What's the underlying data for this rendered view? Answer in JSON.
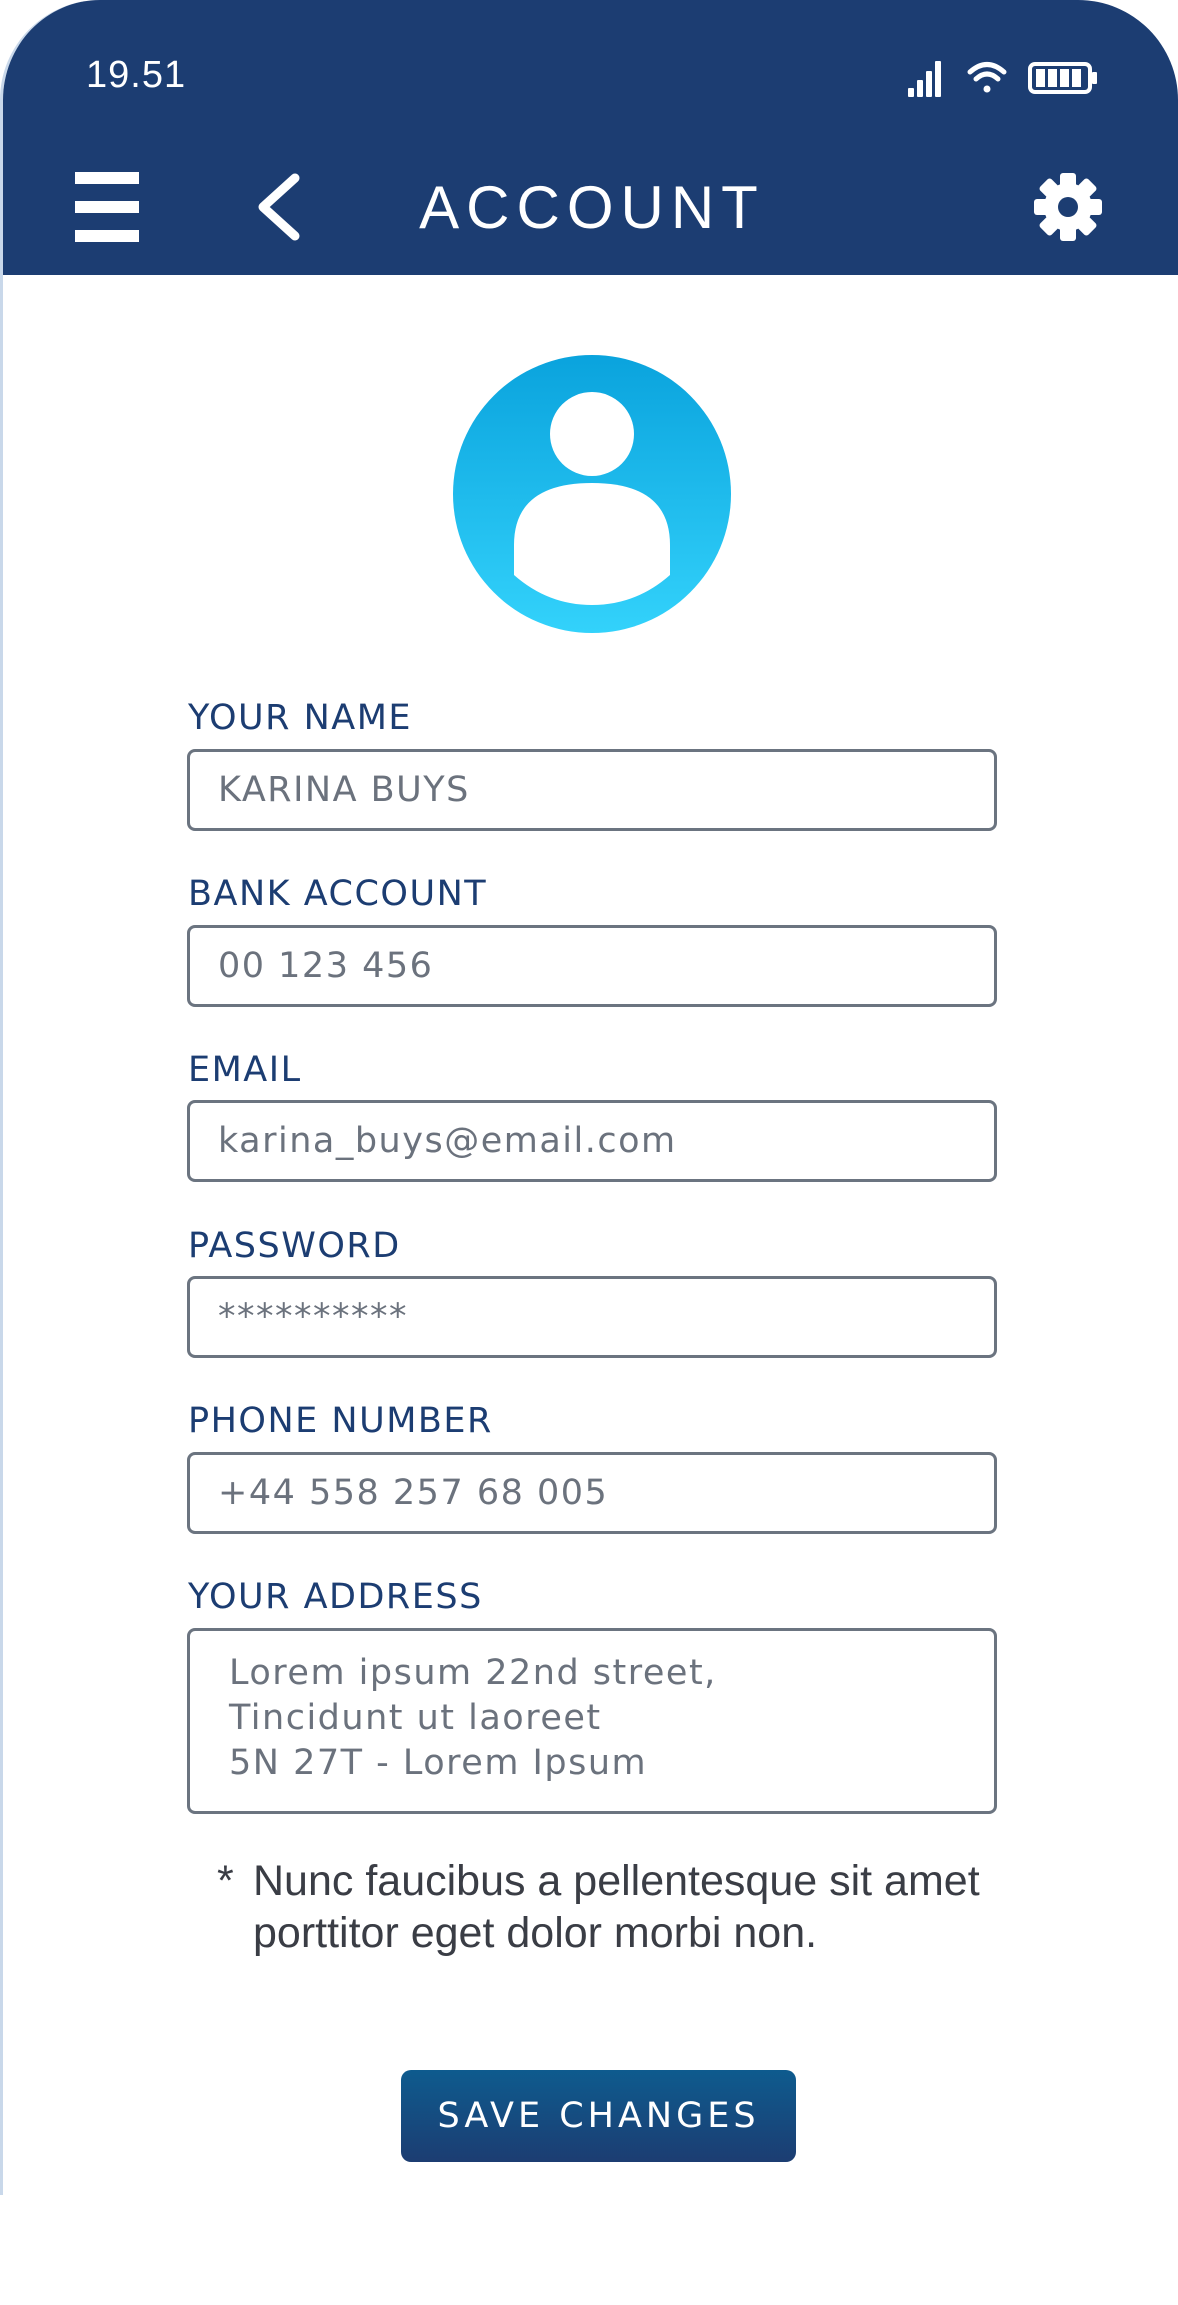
{
  "status_bar": {
    "time": "19.51",
    "icons": [
      "signal-icon",
      "wifi-icon",
      "battery-icon"
    ]
  },
  "header": {
    "title": "ACCOUNT",
    "icons": [
      "menu-icon",
      "back-icon",
      "gear-icon"
    ]
  },
  "avatar": {
    "icon": "user-avatar-icon"
  },
  "form": {
    "name": {
      "label": "YOUR NAME",
      "value": "KARINA BUYS"
    },
    "bank_account": {
      "label": "BANK ACCOUNT",
      "value": "00 123 456"
    },
    "email": {
      "label": "EMAIL",
      "value": "karina_buys@email.com"
    },
    "password": {
      "label": "PASSWORD",
      "value": "**********"
    },
    "phone": {
      "label": "PHONE NUMBER",
      "value": "+44 558 257 68 005"
    },
    "address": {
      "label": "YOUR ADDRESS",
      "lines": [
        "Lorem ipsum 22nd street,",
        "Tincidunt ut laoreet",
        "5N 27T - Lorem Ipsum"
      ]
    }
  },
  "note": {
    "marker": "*",
    "text": "Nunc faucibus a pellentesque sit amet porttitor eget dolor morbi non."
  },
  "actions": {
    "save_label": "SAVE CHANGES"
  },
  "colors": {
    "header_bg": "#1c3d72",
    "label_text": "#1c3d72",
    "input_text": "#6b727d",
    "avatar_gradient_top": "#0aa3dd",
    "avatar_gradient_bottom": "#33d2fb",
    "button_gradient_top": "#0e5b8e",
    "button_gradient_bottom": "#1c3d72"
  }
}
